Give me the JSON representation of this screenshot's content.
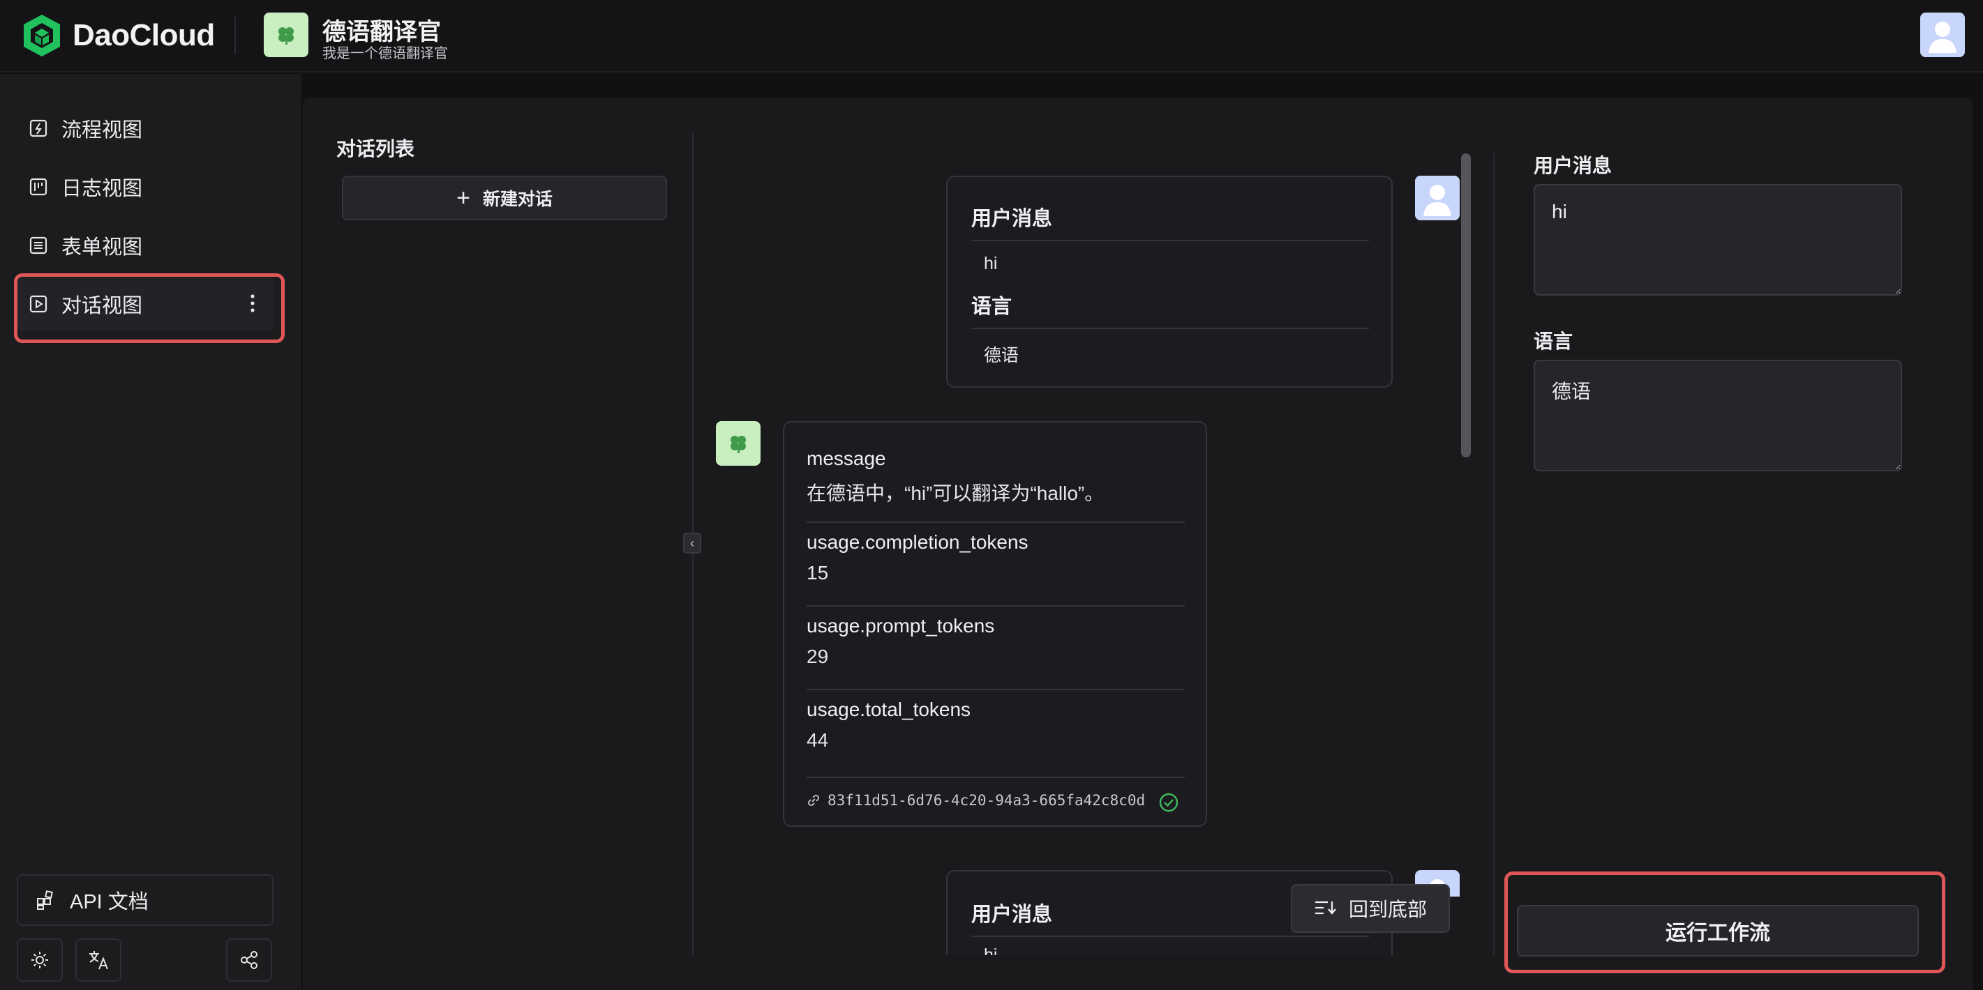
{
  "header": {
    "brand": "DaoCloud",
    "app_name": "德语翻译官",
    "app_description": "我是一个德语翻译官"
  },
  "sidebar": {
    "items": [
      {
        "label": "流程视图",
        "icon": "flow-icon",
        "active": false
      },
      {
        "label": "日志视图",
        "icon": "log-icon",
        "active": false
      },
      {
        "label": "表单视图",
        "icon": "form-icon",
        "active": false
      },
      {
        "label": "对话视图",
        "icon": "chat-view-icon",
        "active": true
      }
    ],
    "api_docs_label": "API 文档"
  },
  "conversations": {
    "title": "对话列表",
    "new_label": "新建对话"
  },
  "chat": {
    "user_message_1": {
      "user_label": "用户消息",
      "user_value": "hi",
      "language_label": "语言",
      "language_value": "德语"
    },
    "response": {
      "message_key": "message",
      "message_value": "在德语中，“hi”可以翻译为“hallo”。",
      "completion_key": "usage.completion_tokens",
      "completion_value": "15",
      "prompt_key": "usage.prompt_tokens",
      "prompt_value": "29",
      "total_key": "usage.total_tokens",
      "total_value": "44",
      "run_id": "83f11d51-6d76-4c20-94a3-665fa42c8c0d",
      "status": "success"
    },
    "user_message_2": {
      "user_label": "用户消息",
      "user_value_partial": "hi"
    },
    "back_to_bottom_label": "回到底部"
  },
  "form": {
    "user_message_label": "用户消息",
    "user_message_value": "hi",
    "language_label": "语言",
    "language_value": "德语",
    "run_label": "运行工作流"
  },
  "colors": {
    "highlight": "#e05656",
    "success": "#3fb95c",
    "brand_green": "#1db954"
  }
}
